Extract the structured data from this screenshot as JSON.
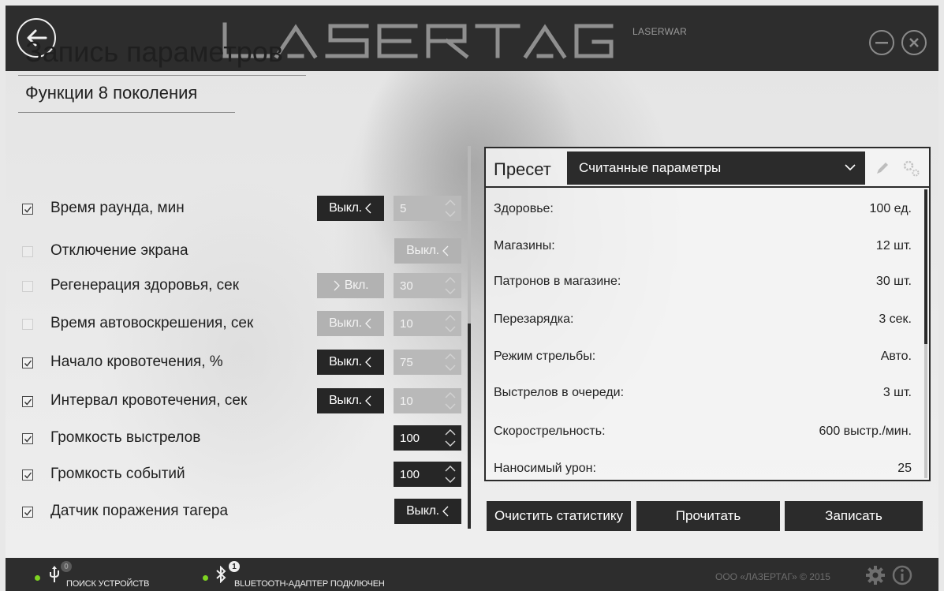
{
  "header": {
    "logo_text": "LASERTAG",
    "logo_subtext": "LASERWAR"
  },
  "page": {
    "title": "Запись параметров",
    "section_title": "Функции 8 поколения"
  },
  "settings": [
    {
      "label": "Время раунда, мин",
      "checked": true,
      "toggle": "Выкл.",
      "toggle_style": "dark",
      "toggle_arrow": "left",
      "value": "5",
      "value_style": "light"
    },
    {
      "label": "Отключение экрана",
      "checked": false,
      "toggle": "Выкл.",
      "toggle_style": "light",
      "toggle_arrow": "left",
      "value": "",
      "value_style": "none"
    },
    {
      "label": "Регенерация здоровья, сек",
      "checked": false,
      "toggle": "Вкл.",
      "toggle_style": "light",
      "toggle_arrow": "right",
      "value": "30",
      "value_style": "light"
    },
    {
      "label": "Время автовоскрешения, сек",
      "checked": false,
      "toggle": "Выкл.",
      "toggle_style": "light",
      "toggle_arrow": "left",
      "value": "10",
      "value_style": "light"
    },
    {
      "label": "Начало кровотечения, %",
      "checked": true,
      "toggle": "Выкл.",
      "toggle_style": "dark",
      "toggle_arrow": "left",
      "value": "75",
      "value_style": "light"
    },
    {
      "label": "Интервал кровотечения, сек",
      "checked": true,
      "toggle": "Выкл.",
      "toggle_style": "dark",
      "toggle_arrow": "left",
      "value": "10",
      "value_style": "light"
    },
    {
      "label": "Громкость выстрелов",
      "checked": true,
      "toggle": "",
      "toggle_style": "none",
      "toggle_arrow": "",
      "value": "100",
      "value_style": "dark"
    },
    {
      "label": "Громкость событий",
      "checked": true,
      "toggle": "",
      "toggle_style": "none",
      "toggle_arrow": "",
      "value": "100",
      "value_style": "dark"
    },
    {
      "label": "Датчик поражения тагера",
      "checked": true,
      "toggle": "Выкл.",
      "toggle_style": "dark",
      "toggle_arrow": "left",
      "value": "",
      "value_style": "none"
    }
  ],
  "preset": {
    "label": "Пресет",
    "selected": "Считанные параметры"
  },
  "parameters": [
    {
      "label": "Здоровье:",
      "value": "100 ед."
    },
    {
      "label": "Магазины:",
      "value": "12 шт."
    },
    {
      "label": "Патронов в магазине:",
      "value": "30 шт."
    },
    {
      "label": "Перезарядка:",
      "value": "3 сек."
    },
    {
      "label": "Режим стрельбы:",
      "value": "Авто."
    },
    {
      "label": "Выстрелов в очереди:",
      "value": "3 шт."
    },
    {
      "label": "Скорострельность:",
      "value": "600 выстр./мин."
    },
    {
      "label": "Наносимый урон:",
      "value": "25"
    }
  ],
  "actions": {
    "clear_stats": "Очистить статистику",
    "read": "Прочитать",
    "write": "Записать"
  },
  "status": {
    "usb_count": "0",
    "usb_text": "ПОИСК УСТРОЙСТВ",
    "bt_count": "1",
    "bt_text": "BLUETOOTH-АДАПТЕР ПОДКЛЮЧЕН",
    "copyright": "ООО «ЛАЗЕРТАГ» © 2015"
  },
  "colors": {
    "bar": "#2d2d2d",
    "control_dark": "#262626",
    "control_disabled": "#b2b2b2",
    "status_dot": "#7ed321"
  },
  "icons": [
    "back-arrow-icon",
    "minimize-icon",
    "close-icon",
    "checkmark-icon",
    "chevron-left-icon",
    "chevron-right-icon",
    "spinner-arrows-icon",
    "chevron-down-icon",
    "pencil-icon",
    "gear-icon",
    "usb-icon",
    "bluetooth-icon",
    "settings-gear-icon",
    "info-icon"
  ]
}
